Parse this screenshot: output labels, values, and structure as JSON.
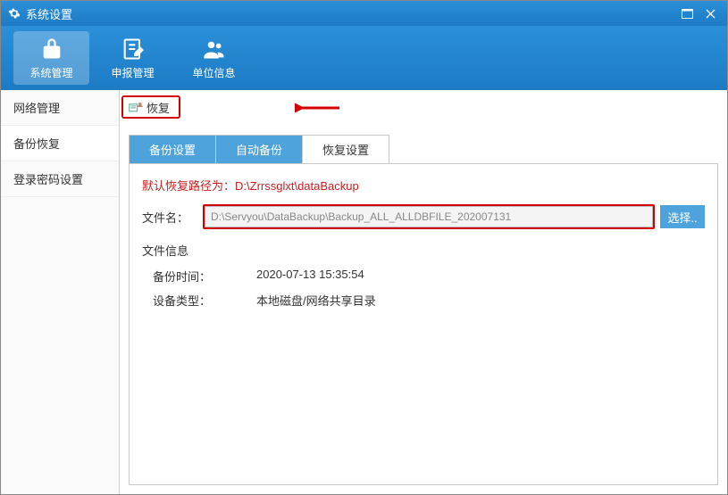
{
  "titlebar": {
    "title": "系统设置"
  },
  "toolbar": {
    "items": [
      {
        "label": "系统管理"
      },
      {
        "label": "申报管理"
      },
      {
        "label": "单位信息"
      }
    ]
  },
  "sidebar": {
    "items": [
      {
        "label": "网络管理"
      },
      {
        "label": "备份恢复"
      },
      {
        "label": "登录密码设置"
      }
    ]
  },
  "restore_btn": {
    "label": "恢复"
  },
  "tabs": [
    {
      "label": "备份设置"
    },
    {
      "label": "自动备份"
    },
    {
      "label": "恢复设置"
    }
  ],
  "panel": {
    "default_path_prefix": "默认恢复路径为：",
    "default_path_value": "D:\\Zrrssglxt\\dataBackup",
    "file_label": "文件名：",
    "file_value": "D:\\Servyou\\DataBackup\\Backup_ALL_ALLDBFILE_202007131",
    "browse_label": "选择..",
    "info_title": "文件信息",
    "backup_time_label": "备份时间：",
    "backup_time_value": "2020-07-13 15:35:54",
    "device_type_label": "设备类型：",
    "device_type_value": "本地磁盘/网络共享目录"
  }
}
